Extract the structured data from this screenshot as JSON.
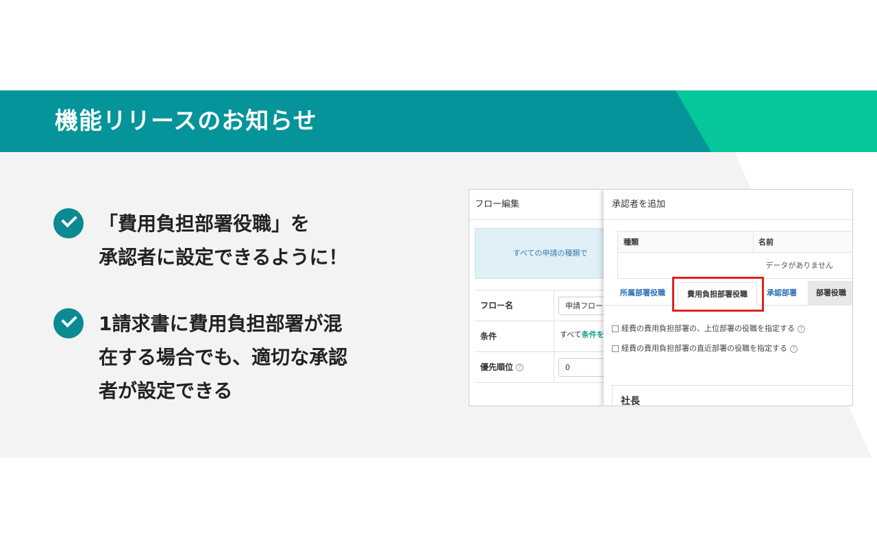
{
  "banner": {
    "title": "機能リリースのお知らせ",
    "colors": {
      "teal": "#05949a",
      "green": "#06c79a"
    }
  },
  "bullets": [
    {
      "icon": "check-circle-icon",
      "lines": [
        "「費用負担部署役職」を",
        "承認者に設定できるように！"
      ]
    },
    {
      "icon": "check-circle-icon",
      "lines": [
        "1請求書に費用負担部署が混",
        "在する場合でも、適切な承認",
        "者が設定できる"
      ]
    }
  ],
  "screenshot": {
    "left_panel": {
      "title": "フロー編集",
      "info_text": "すべての申請の種類で",
      "rows": {
        "flow_name": {
          "label": "フロー名",
          "value": "申請フロー"
        },
        "condition": {
          "label": "条件",
          "text_prefix": "すべて",
          "link": "条件を"
        },
        "priority": {
          "label": "優先順位",
          "help": "?",
          "value": "0"
        }
      }
    },
    "right_panel": {
      "title": "承認者を追加",
      "table": {
        "col_type": "種類",
        "col_name": "名前",
        "empty": "データがありません"
      },
      "tabs": [
        "所属部署役職",
        "費用負担部署役職",
        "承認部署",
        "部署役職"
      ],
      "checkboxes": [
        {
          "label": "経費の費用負担部署の、上位部署の役職を指定する",
          "help": "?"
        },
        {
          "label": "経費の費用負担部署の直近部署の役職を指定する",
          "help": "?"
        }
      ],
      "card_title": "社長",
      "highlight_color": "#e02020"
    }
  }
}
